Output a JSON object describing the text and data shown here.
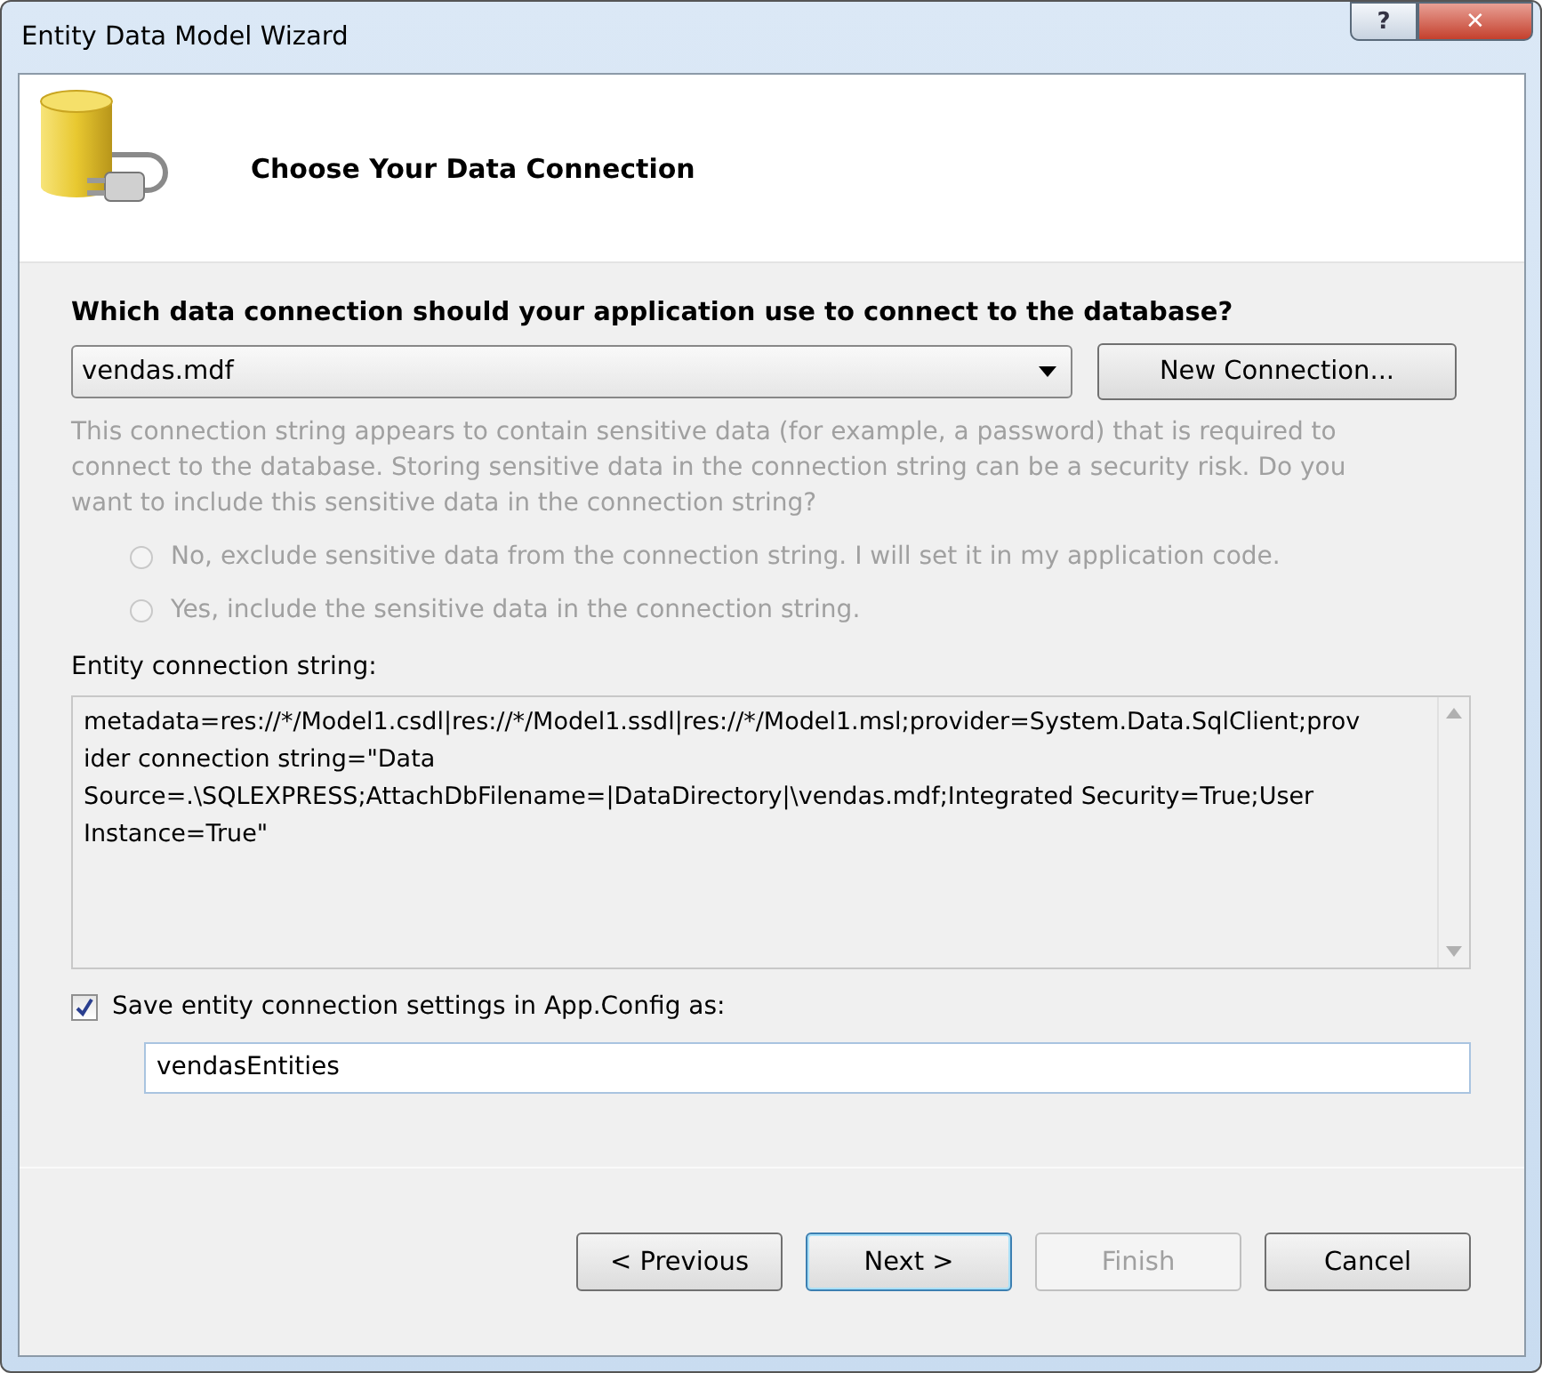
{
  "window": {
    "title": "Entity Data Model Wizard",
    "help_button": "?",
    "close_button": "✕"
  },
  "header": {
    "title": "Choose Your Data Connection"
  },
  "question": "Which data connection should your application use to connect to the database?",
  "connection": {
    "value": "vendas.mdf",
    "new_button": "New Connection..."
  },
  "sensitive": {
    "text": "This connection string appears to contain sensitive data (for example, a password) that is required to connect to the database. Storing sensitive data in the connection string can be a security risk. Do you want to include this sensitive data in the connection string?",
    "disabled": true,
    "options": [
      {
        "label": "No, exclude sensitive data from the connection string. I will set it in my application code.",
        "selected": false
      },
      {
        "label": "Yes, include the sensitive data in the connection string.",
        "selected": false
      }
    ]
  },
  "entity_string": {
    "label": "Entity connection string:",
    "value": "metadata=res://*/Model1.csdl|res://*/Model1.ssdl|res://*/Model1.msl;provider=System.Data.SqlClient;provider connection string=\"Data Source=.\\SQLEXPRESS;AttachDbFilename=|DataDirectory|\\vendas.mdf;Integrated Security=True;User Instance=True\""
  },
  "save": {
    "label": "Save entity connection settings in App.Config as:",
    "checked": true,
    "value": "vendasEntities"
  },
  "buttons": [
    {
      "label": "< Previous",
      "disabled": false,
      "default": false
    },
    {
      "label": "Next >",
      "disabled": false,
      "default": true
    },
    {
      "label": "Finish",
      "disabled": true,
      "default": false
    },
    {
      "label": "Cancel",
      "disabled": false,
      "default": false
    }
  ]
}
